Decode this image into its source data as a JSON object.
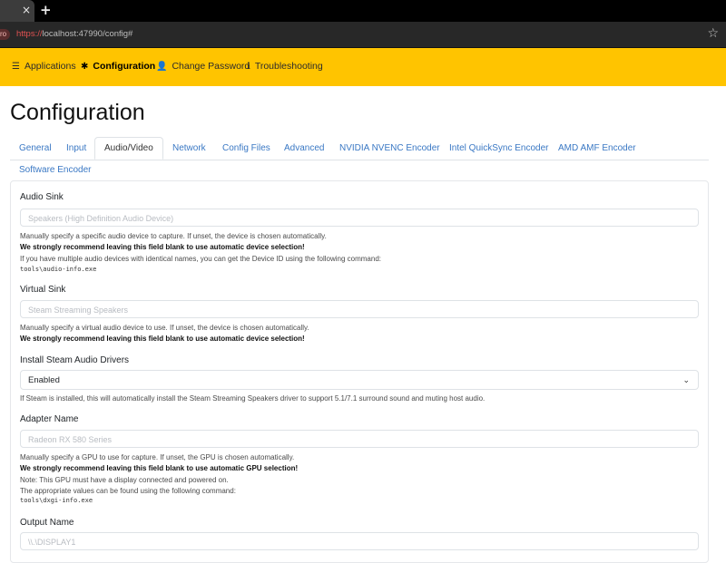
{
  "browser": {
    "tab_close": "×",
    "new_tab": "+",
    "profile_chip": "ro",
    "url_scheme": "https://",
    "url_rest": "localhost:47990/config#",
    "bookmark_icon": "star-icon"
  },
  "navbar": {
    "items": [
      {
        "label": "Applications",
        "icon": "list-icon"
      },
      {
        "label": "Configuration",
        "icon": "gear-icon"
      },
      {
        "label": "Change Password",
        "icon": "user-lock-icon"
      },
      {
        "label": "Troubleshooting",
        "icon": "info-icon"
      }
    ]
  },
  "page": {
    "title": "Configuration"
  },
  "tabs": [
    "General",
    "Input",
    "Audio/Video",
    "Network",
    "Config Files",
    "Advanced",
    "NVIDIA NVENC Encoder",
    "Intel QuickSync Encoder",
    "AMD AMF Encoder",
    "Software Encoder"
  ],
  "active_tab": "Audio/Video",
  "fields": {
    "audio_sink": {
      "label": "Audio Sink",
      "placeholder": "Speakers (High Definition Audio Device)",
      "help1": "Manually specify a specific audio device to capture. If unset, the device is chosen automatically.",
      "help2": "We strongly recommend leaving this field blank to use automatic device selection!",
      "help3": "If you have multiple audio devices with identical names, you can get the Device ID using the following command:",
      "code": "tools\\audio-info.exe"
    },
    "virtual_sink": {
      "label": "Virtual Sink",
      "placeholder": "Steam Streaming Speakers",
      "help1": "Manually specify a virtual audio device to use. If unset, the device is chosen automatically.",
      "help2": "We strongly recommend leaving this field blank to use automatic device selection!"
    },
    "steam_audio": {
      "label": "Install Steam Audio Drivers",
      "value": "Enabled",
      "help1": "If Steam is installed, this will automatically install the Steam Streaming Speakers driver to support 5.1/7.1 surround sound and muting host audio."
    },
    "adapter_name": {
      "label": "Adapter Name",
      "placeholder": "Radeon RX 580 Series",
      "help1": "Manually specify a GPU to use for capture. If unset, the GPU is chosen automatically.",
      "help2": "We strongly recommend leaving this field blank to use automatic GPU selection!",
      "help3": "Note: This GPU must have a display connected and powered on.",
      "help4": "The appropriate values can be found using the following command:",
      "code": "tools\\dxgi-info.exe"
    },
    "output_name": {
      "label": "Output Name",
      "placeholder": "\\\\.\\DISPLAY1"
    }
  },
  "colors": {
    "navbar": "#ffc400",
    "link": "#3a78c4",
    "chrome": "#282828"
  }
}
